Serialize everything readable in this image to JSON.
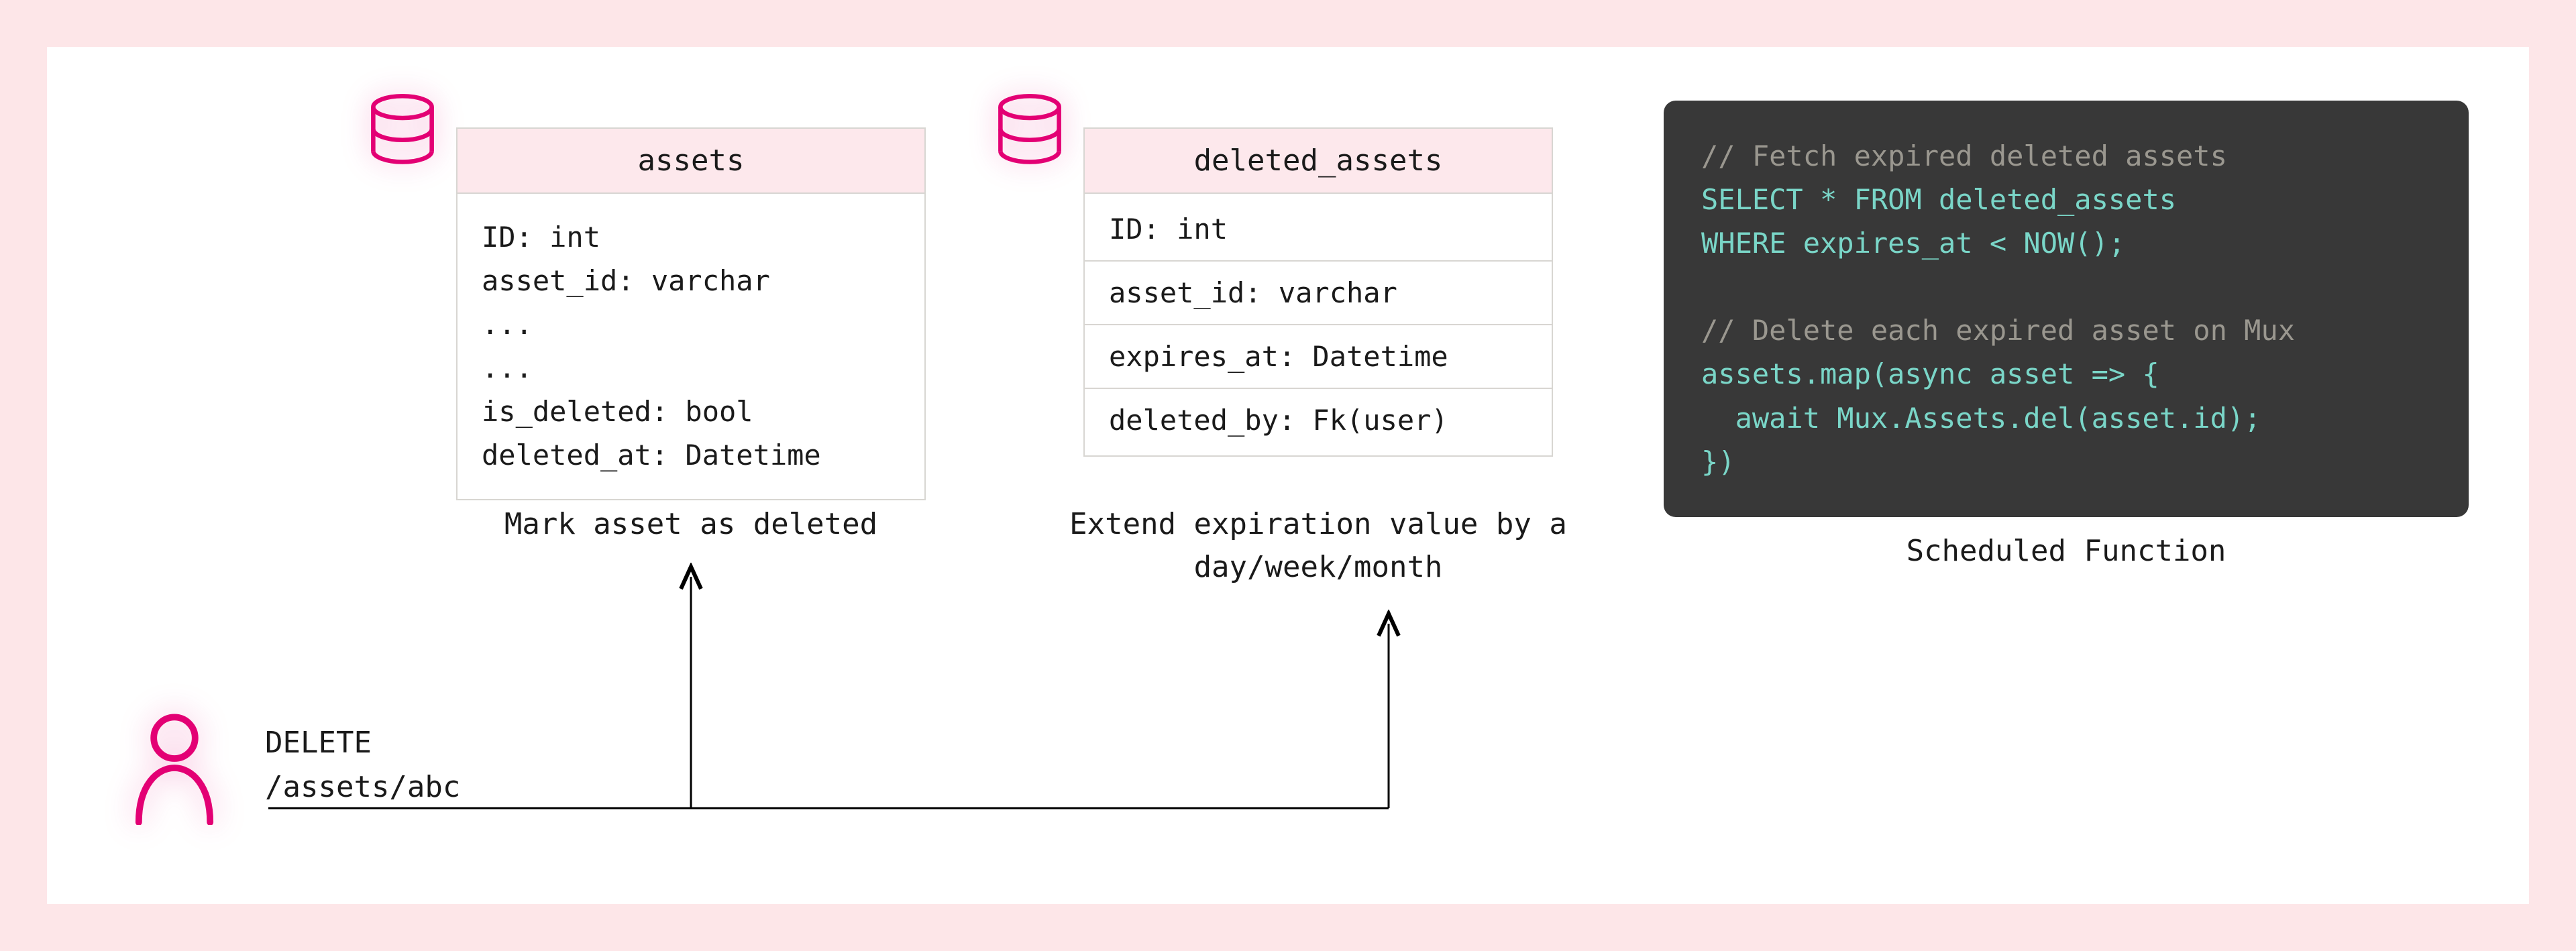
{
  "tables": {
    "assets": {
      "name": "assets",
      "body": "ID: int\nasset_id: varchar\n...\n...\nis_deleted: bool\ndeleted_at: Datetime",
      "caption": "Mark asset as deleted"
    },
    "deleted": {
      "name": "deleted_assets",
      "rows": {
        "r0": "ID: int",
        "r1": "asset_id: varchar",
        "r2": "expires_at: Datetime",
        "r3": "deleted_by: Fk(user)"
      },
      "caption": "Extend expiration value\nby a day/week/month"
    }
  },
  "code": {
    "c1": "// Fetch expired deleted assets",
    "l2": "SELECT * FROM deleted_assets",
    "l3": "WHERE expires_at < NOW();",
    "c2": "// Delete each expired asset on Mux",
    "l5": "assets.map(async asset => {",
    "l6": "  await Mux.Assets.del(asset.id);",
    "l7": "})",
    "caption": "Scheduled Function"
  },
  "request": {
    "method": "DELETE",
    "path": "/assets/abc"
  }
}
